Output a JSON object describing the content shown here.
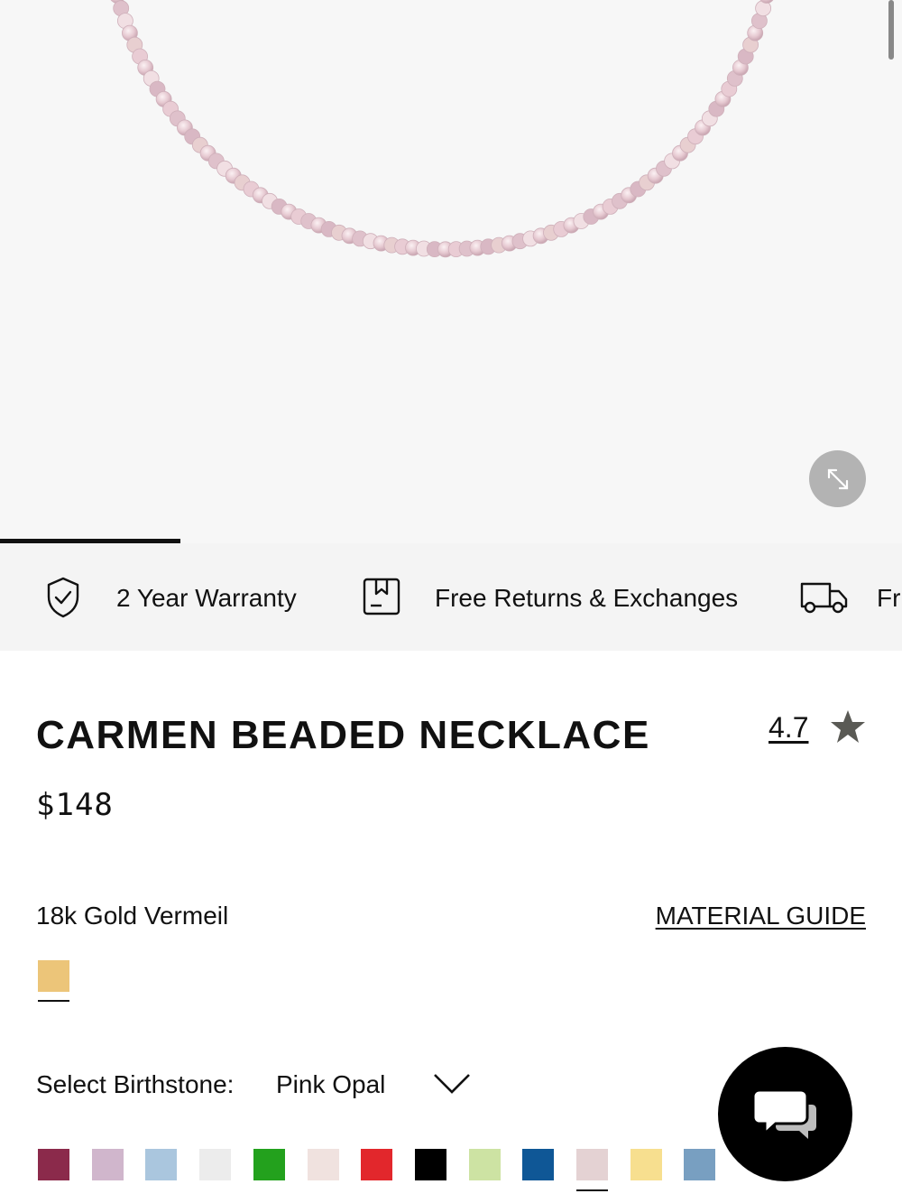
{
  "gallery": {
    "image_alt": "Carmen beaded necklace",
    "expand_icon": "expand-arrows-icon",
    "slide_progress": 0.2
  },
  "benefits": [
    {
      "icon": "shield-check-icon",
      "label": "2 Year Warranty"
    },
    {
      "icon": "return-box-icon",
      "label": "Free Returns & Exchanges"
    },
    {
      "icon": "delivery-truck-icon",
      "label": "Fr"
    }
  ],
  "product": {
    "title": "CARMEN BEADED NECKLACE",
    "rating": "4.7",
    "price": "$148"
  },
  "material": {
    "label": "18k Gold Vermeil",
    "guide_link": "MATERIAL GUIDE",
    "swatch_color": "#ecc579"
  },
  "birthstone": {
    "label": "Select Birthstone:",
    "selected": "Pink Opal",
    "swatches": [
      "#8b2a4b",
      "#d0b6cc",
      "#aac6de",
      "#ececec",
      "#23a11d",
      "#f0e2df",
      "#e2272c",
      "#000000",
      "#cde3a3",
      "#0f5796",
      "#e4d2d3",
      "#f7df8f",
      "#789fc1"
    ],
    "selected_index": 10
  },
  "colors": {
    "accent": "#111111",
    "gallery_bg": "#f7f7f7",
    "benefits_bg": "#f4f4f4"
  }
}
